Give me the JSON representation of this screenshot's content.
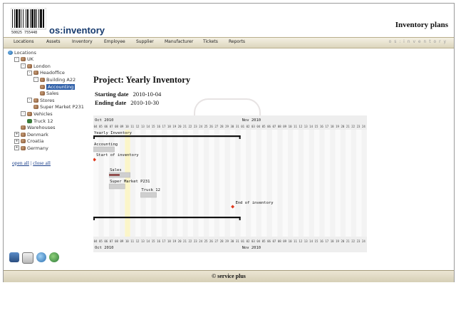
{
  "header": {
    "barcode_number": "50025 755448",
    "brand": "os:inventory",
    "page_title": "Inventory plans"
  },
  "menu": {
    "items": [
      "Locations",
      "Assets",
      "Inventory",
      "Employee",
      "Supplier",
      "Manufacturer",
      "Tickets",
      "Reports"
    ],
    "brand_text": "o s : i n v e n t o r y"
  },
  "tree": {
    "nodes": [
      {
        "label": "Locations",
        "icon": "globe-icon",
        "expander": ""
      },
      {
        "label": "UK",
        "icon": "building-icon",
        "expander": "-"
      },
      {
        "label": "London",
        "icon": "building-icon",
        "expander": "-"
      },
      {
        "label": "Headoffice",
        "icon": "building-icon",
        "expander": "-"
      },
      {
        "label": "Building A22",
        "icon": "building-icon",
        "expander": "-"
      },
      {
        "label": "Accounting",
        "icon": "building-icon",
        "expander": "",
        "selected": true
      },
      {
        "label": "Sales",
        "icon": "building-icon",
        "expander": ""
      },
      {
        "label": "Stores",
        "icon": "building-icon",
        "expander": "-"
      },
      {
        "label": "Super Market P231",
        "icon": "building-icon",
        "expander": ""
      },
      {
        "label": "Vehicles",
        "icon": "building-icon",
        "expander": "-"
      },
      {
        "label": "Truck 12",
        "icon": "truck-icon",
        "expander": ""
      },
      {
        "label": "Warehouses",
        "icon": "building-icon",
        "expander": ""
      },
      {
        "label": "Denmark",
        "icon": "building-icon",
        "expander": "+"
      },
      {
        "label": "Croatia",
        "icon": "building-icon",
        "expander": "+"
      },
      {
        "label": "Germany",
        "icon": "building-icon",
        "expander": "+"
      }
    ],
    "open_all": "open all",
    "separator": "|",
    "close_all": "close all"
  },
  "bottom_icons": [
    "computer-icon",
    "document-icon",
    "search-icon",
    "globe-icon"
  ],
  "project": {
    "title": "Project: Yearly Inventory",
    "start_label": "Starting date",
    "start_value": "2010-10-04",
    "end_label": "Ending date",
    "end_value": "2010-10-30"
  },
  "gantt": {
    "months": [
      "Oct 2010",
      "Nov 2010"
    ],
    "days": [
      "04",
      "05",
      "06",
      "07",
      "08",
      "09",
      "10",
      "11",
      "12",
      "13",
      "14",
      "15",
      "16",
      "17",
      "18",
      "19",
      "20",
      "21",
      "22",
      "23",
      "24",
      "25",
      "26",
      "27",
      "28",
      "29",
      "30",
      "31",
      "01",
      "02",
      "03",
      "04",
      "05",
      "06",
      "07",
      "08",
      "09",
      "10",
      "11",
      "12",
      "13",
      "14",
      "15",
      "16",
      "17",
      "18",
      "19",
      "20",
      "21",
      "22",
      "23",
      "24"
    ],
    "today_index": 6,
    "tasks": [
      {
        "label": "Yearly Inventory",
        "kind": "summary",
        "start": 0,
        "end": 27
      },
      {
        "label": "Accounting",
        "kind": "task",
        "start": 0,
        "end": 3
      },
      {
        "label": "Start of inventory",
        "kind": "milestone",
        "start": 0,
        "end": 0
      },
      {
        "label": "Sales",
        "kind": "task",
        "start": 3,
        "end": 6,
        "progress": 0.5
      },
      {
        "label": "Super Market P231",
        "kind": "task",
        "start": 3,
        "end": 5
      },
      {
        "label": "Truck 12",
        "kind": "task",
        "start": 9,
        "end": 11
      },
      {
        "label": "End of inventory",
        "kind": "milestone",
        "start": 26,
        "end": 26
      },
      {
        "label": "",
        "kind": "summary",
        "start": 0,
        "end": 27
      }
    ],
    "colors": {
      "bar": "#cfcfcf",
      "summary": "#111111",
      "milestone": "#e03a1e",
      "progress": "#7a1a1a",
      "today": "#fbf5c9"
    }
  },
  "footer": {
    "text": "© service plus"
  }
}
